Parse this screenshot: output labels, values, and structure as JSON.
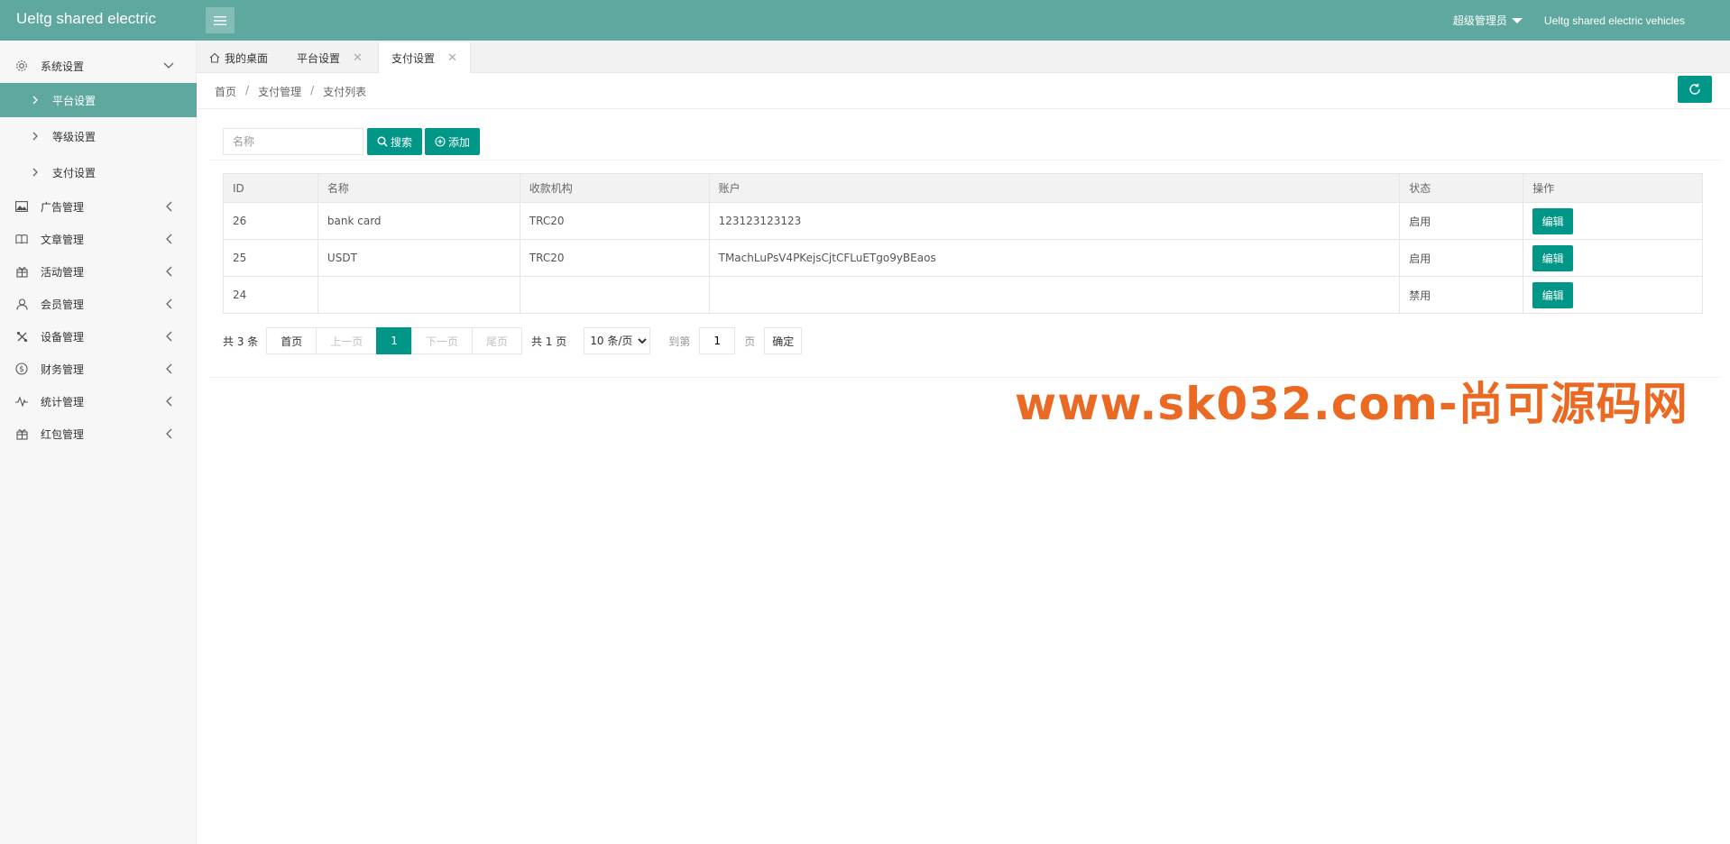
{
  "header": {
    "logo": "Ueltg shared electric",
    "user": "超级管理员",
    "app_name": "Ueltg shared electric vehicles"
  },
  "sidebar": {
    "groups": [
      {
        "label": "系统设置",
        "icon": "gear-icon",
        "expanded": true,
        "children": [
          {
            "label": "平台设置",
            "active": true
          },
          {
            "label": "等级设置",
            "active": false
          },
          {
            "label": "支付设置",
            "active": false
          }
        ]
      },
      {
        "label": "广告管理",
        "icon": "image-icon"
      },
      {
        "label": "文章管理",
        "icon": "book-icon"
      },
      {
        "label": "活动管理",
        "icon": "gift-icon"
      },
      {
        "label": "会员管理",
        "icon": "user-icon"
      },
      {
        "label": "设备管理",
        "icon": "tools-icon"
      },
      {
        "label": "财务管理",
        "icon": "dollar-icon"
      },
      {
        "label": "统计管理",
        "icon": "pulse-icon"
      },
      {
        "label": "红包管理",
        "icon": "gift-icon"
      }
    ]
  },
  "tabs": [
    {
      "label": "我的桌面",
      "icon": "home-icon",
      "closable": false
    },
    {
      "label": "平台设置",
      "closable": true
    },
    {
      "label": "支付设置",
      "closable": true,
      "active": true
    }
  ],
  "breadcrumb": [
    "首页",
    "支付管理",
    "支付列表"
  ],
  "search": {
    "placeholder": "名称",
    "search_label": "搜索",
    "add_label": "添加"
  },
  "table": {
    "columns": [
      "ID",
      "名称",
      "收款机构",
      "账户",
      "状态",
      "操作"
    ],
    "rows": [
      {
        "id": "26",
        "name": "bank card",
        "org": "TRC20",
        "account": "123123123123",
        "status": "启用",
        "enabled": true,
        "action": "编辑"
      },
      {
        "id": "25",
        "name": "USDT",
        "org": "TRC20",
        "account": "TMachLuPsV4PKejsCjtCFLuETgo9yBEaos",
        "status": "启用",
        "enabled": true,
        "action": "编辑"
      },
      {
        "id": "24",
        "name": "",
        "org": "",
        "account": "",
        "status": "禁用",
        "enabled": false,
        "action": "编辑"
      }
    ]
  },
  "pager": {
    "total": "共 3 条",
    "first": "首页",
    "prev": "上一页",
    "current": "1",
    "next": "下一页",
    "last": "尾页",
    "pages": "共 1 页",
    "page_size": "10 条/页",
    "goto": "到第",
    "goto_value": "1",
    "page_unit": "页",
    "confirm": "确定"
  },
  "watermark": "www.sk032.com-尚可源码网",
  "colors": {
    "header": "#5fa89f",
    "primary": "#009688",
    "enabled": "#5fb878",
    "watermark": "#ea6a23"
  }
}
